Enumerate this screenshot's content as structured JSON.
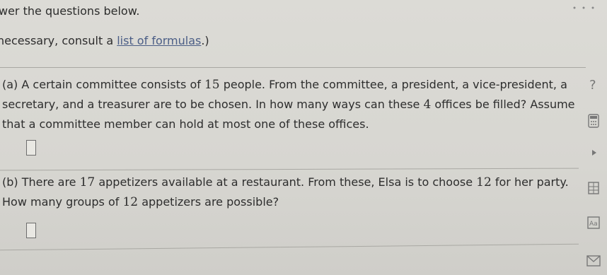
{
  "header": {
    "instruction": "wer the questions below.",
    "consult_prefix": "necessary, consult a ",
    "consult_link": "list of formulas",
    "consult_suffix": ".)"
  },
  "part_a": {
    "label": "(a)",
    "line1_pre": "A certain committee consists of ",
    "n1": "15",
    "line1_post": " people. From the committee, a president, a vice-president, a",
    "line2_pre": "secretary, and a treasurer are to be chosen. In how many ways can these ",
    "n2": "4",
    "line2_post": " offices be filled? Assume",
    "line3": "that a committee member can hold at most one of these offices.",
    "answer_value": ""
  },
  "part_b": {
    "label": "(b)",
    "line1_pre": "There are ",
    "n1": "17",
    "line1_mid": " appetizers available at a restaurant. From these, Elsa is to choose ",
    "n2": "12",
    "line1_post": " for her party.",
    "line2_pre": "How many groups of ",
    "n3": "12",
    "line2_post": " appetizers are possible?",
    "answer_value": ""
  },
  "sidebar": {
    "help": "?",
    "textbox_label": "Aa"
  }
}
